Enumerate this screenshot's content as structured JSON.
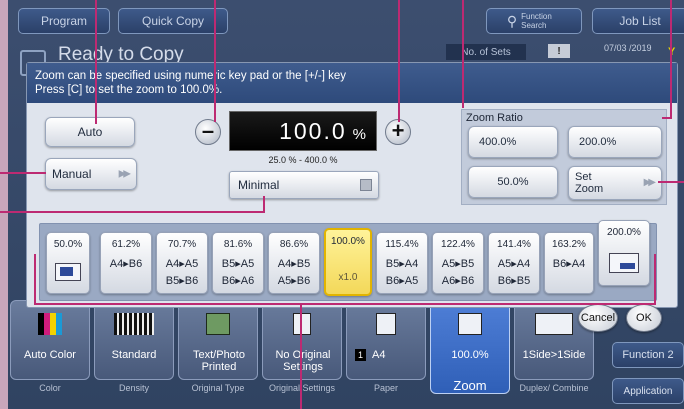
{
  "top_bar": {
    "program": "Program",
    "quick_copy": "Quick Copy",
    "function_search": "Function Search",
    "job_list": "Job List"
  },
  "status": {
    "ready": "Ready to Copy",
    "no_of_sets": "No. of Sets",
    "datetime": "07/03 /2019",
    "toner_letter": "Y"
  },
  "dialog": {
    "header_line1": "Zoom can be specified using numeric key pad or the [+/-] key",
    "header_line2": "Press [C] to set the zoom to 100.0%.",
    "auto": "Auto",
    "manual": "Manual",
    "zoom_value": "100.0",
    "zoom_unit": "%",
    "range": "25.0 % - 400.0 %",
    "minimal": "Minimal",
    "zoom_ratio_title": "Zoom Ratio",
    "ratio_400": "400.0%",
    "ratio_200": "200.0%",
    "ratio_50": "50.0%",
    "set_zoom_l1": "Set",
    "set_zoom_l2": "Zoom",
    "cancel": "Cancel",
    "ok": "OK"
  },
  "presets": [
    {
      "pct": "50.0%",
      "l1": "",
      "l2": ""
    },
    {
      "pct": "61.2%",
      "l1": "A4▸B6",
      "l2": ""
    },
    {
      "pct": "70.7%",
      "l1": "A4▸A5",
      "l2": "B5▸B6"
    },
    {
      "pct": "81.6%",
      "l1": "B5▸A5",
      "l2": "B6▸A6"
    },
    {
      "pct": "86.6%",
      "l1": "A4▸B5",
      "l2": "A5▸B6"
    },
    {
      "pct": "100.0%",
      "l1": "",
      "l2": "x1.0"
    },
    {
      "pct": "115.4%",
      "l1": "B5▸A4",
      "l2": "B6▸A5"
    },
    {
      "pct": "122.4%",
      "l1": "A5▸B5",
      "l2": "A6▸B6"
    },
    {
      "pct": "141.4%",
      "l1": "A5▸A4",
      "l2": "B6▸B5"
    },
    {
      "pct": "163.2%",
      "l1": "B6▸A4",
      "l2": ""
    },
    {
      "pct": "200.0%",
      "l1": "",
      "l2": ""
    }
  ],
  "function_tabs": [
    {
      "value": "Auto Color",
      "label": "Color"
    },
    {
      "value": "Standard",
      "label": "Density"
    },
    {
      "value": "Text/Photo Printed",
      "label": "Original Type"
    },
    {
      "value": "No Original Settings",
      "label": "Original Settings"
    },
    {
      "value": "A4",
      "label": "Paper"
    },
    {
      "value": "100.0%",
      "label": "Zoom"
    },
    {
      "value": "1Side>1Side",
      "label": "Duplex/ Combine"
    }
  ],
  "side_buttons": {
    "function2": "Function 2",
    "application": "Application"
  },
  "colors": {
    "callout": "#bd2a72",
    "header": "#34507f",
    "selected": "#f5dc5e"
  }
}
